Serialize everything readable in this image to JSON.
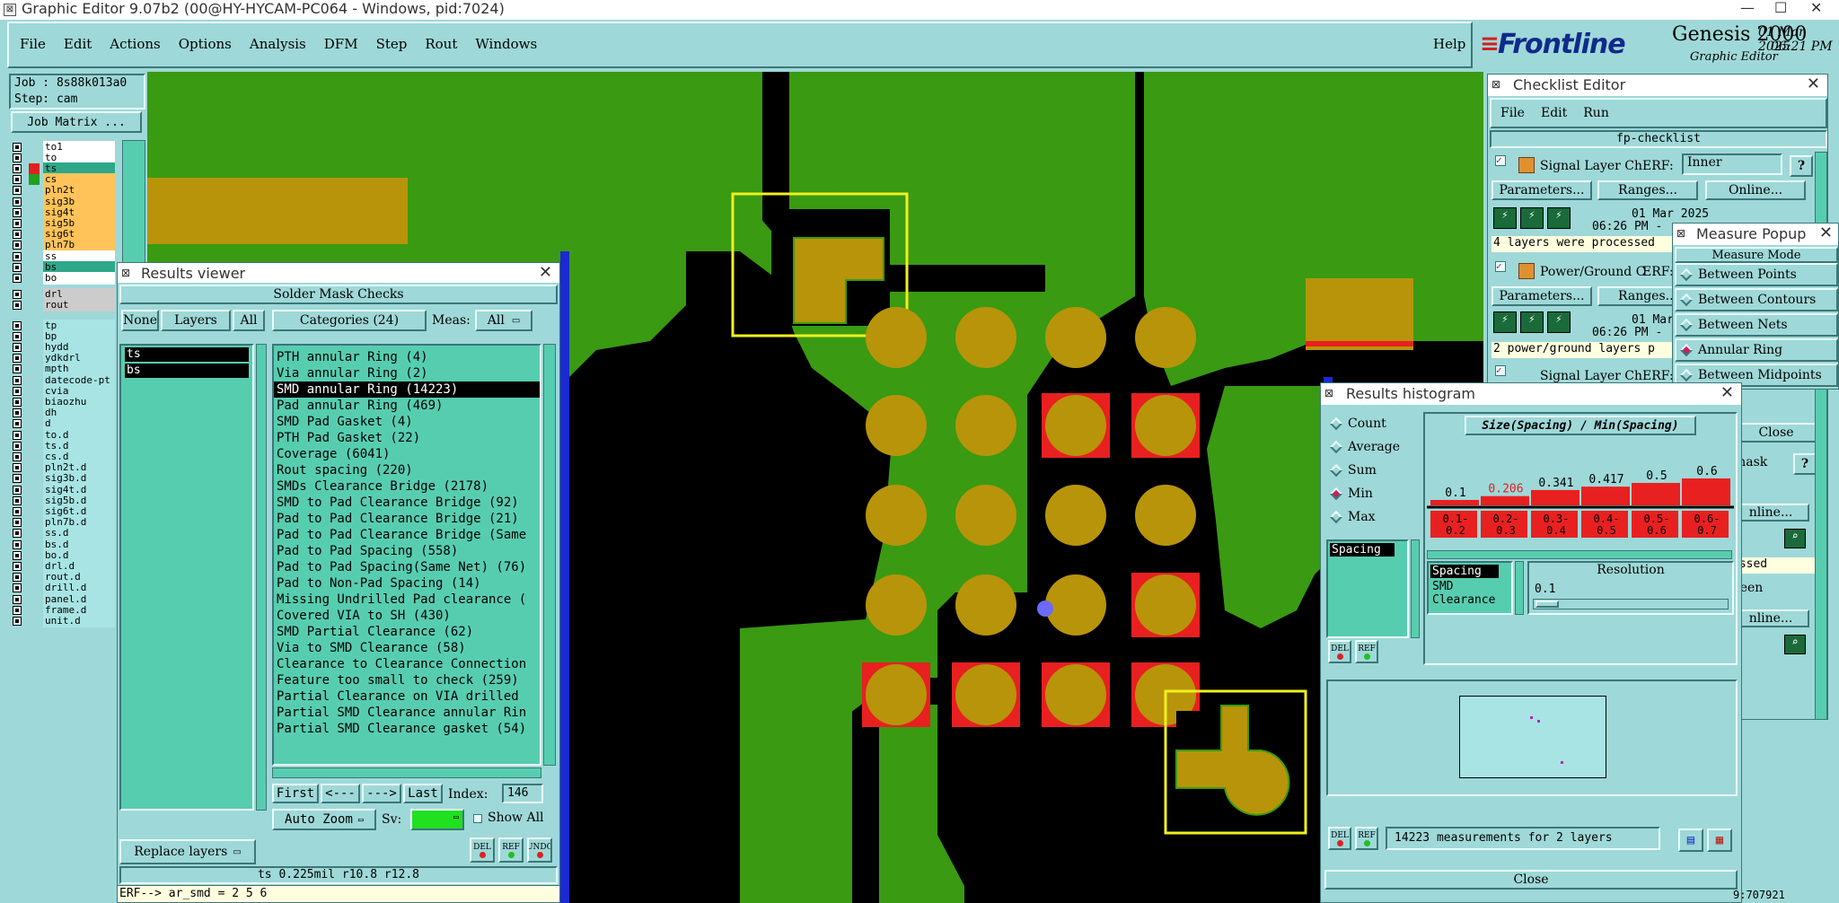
{
  "window": {
    "title": "Graphic Editor 9.07b2 (00@HY-HYCAM-PC064 - Windows, pid:7024)",
    "min_glyph": "—",
    "max_glyph": "☐",
    "close_glyph": "✕"
  },
  "menu": {
    "items": [
      "File",
      "Edit",
      "Actions",
      "Options",
      "Analysis",
      "DFM",
      "Step",
      "Rout",
      "Windows"
    ],
    "help": "Help"
  },
  "brand": {
    "logo": "Frontline",
    "product": "Genesis 2000",
    "subtitle": "Graphic Editor",
    "date": "01 Mar 2025",
    "time": "06:21 PM"
  },
  "job": {
    "job_label": "Job : 8s88k013a0",
    "step_label": "Step: cam",
    "matrix_button": "Job Matrix ..."
  },
  "layers": [
    {
      "name": "to1",
      "color": "#ffffff"
    },
    {
      "name": "to",
      "color": "#ffffff"
    },
    {
      "name": "ts",
      "color": "#2ea888"
    },
    {
      "name": "cs",
      "color": "#ffc35a"
    },
    {
      "name": "pln2t",
      "color": "#ffc35a"
    },
    {
      "name": "sig3b",
      "color": "#ffc35a"
    },
    {
      "name": "sig4t",
      "color": "#ffc35a"
    },
    {
      "name": "sig5b",
      "color": "#ffc35a"
    },
    {
      "name": "sig6t",
      "color": "#ffc35a"
    },
    {
      "name": "pln7b",
      "color": "#ffc35a"
    },
    {
      "name": "ss",
      "color": "#ffffff"
    },
    {
      "name": "bs",
      "color": "#2ea888"
    },
    {
      "name": "bo",
      "color": "#ffffff"
    },
    {
      "name": "drl",
      "color": "#cccccc"
    },
    {
      "name": "rout",
      "color": "#cccccc"
    },
    {
      "name": "tp",
      "color": "#a8e4e4"
    },
    {
      "name": "bp",
      "color": "#a8e4e4"
    },
    {
      "name": "hydd",
      "color": "#a8e4e4"
    },
    {
      "name": "ydkdrl",
      "color": "#a8e4e4"
    },
    {
      "name": "mpth",
      "color": "#a8e4e4"
    },
    {
      "name": "datecode-pt",
      "color": "#a8e4e4"
    },
    {
      "name": "cvia",
      "color": "#a8e4e4"
    },
    {
      "name": "biaozhu",
      "color": "#a8e4e4"
    },
    {
      "name": "dh",
      "color": "#a8e4e4"
    },
    {
      "name": "d",
      "color": "#a8e4e4"
    },
    {
      "name": "to.d",
      "color": "#a8e4e4"
    },
    {
      "name": "ts.d",
      "color": "#a8e4e4"
    },
    {
      "name": "cs.d",
      "color": "#a8e4e4"
    },
    {
      "name": "pln2t.d",
      "color": "#a8e4e4"
    },
    {
      "name": "sig3b.d",
      "color": "#a8e4e4"
    },
    {
      "name": "sig4t.d",
      "color": "#a8e4e4"
    },
    {
      "name": "sig5b.d",
      "color": "#a8e4e4"
    },
    {
      "name": "sig6t.d",
      "color": "#a8e4e4"
    },
    {
      "name": "pln7b.d",
      "color": "#a8e4e4"
    },
    {
      "name": "ss.d",
      "color": "#a8e4e4"
    },
    {
      "name": "bs.d",
      "color": "#a8e4e4"
    },
    {
      "name": "bo.d",
      "color": "#a8e4e4"
    },
    {
      "name": "drl.d",
      "color": "#a8e4e4"
    },
    {
      "name": "rout.d",
      "color": "#a8e4e4"
    },
    {
      "name": "drill.d",
      "color": "#a8e4e4"
    },
    {
      "name": "panel.d",
      "color": "#a8e4e4"
    },
    {
      "name": "frame.d",
      "color": "#a8e4e4"
    },
    {
      "name": "unit.d",
      "color": "#a8e4e4"
    }
  ],
  "results_viewer": {
    "title": "Results viewer",
    "header": "Solder Mask Checks",
    "none_btn": "None",
    "layers_btn": "Layers",
    "all_btn": "All",
    "categories_btn": "Categories (24)",
    "meas_label": "Meas:",
    "meas_value": "All",
    "layer_list": [
      "ts",
      "bs"
    ],
    "categories": [
      "PTH annular Ring (4)",
      "Via annular Ring (2)",
      "SMD annular Ring (14223)",
      "Pad annular Ring (469)",
      "SMD Pad Gasket (4)",
      "PTH Pad Gasket (22)",
      "Coverage (6041)",
      "Rout spacing (220)",
      "SMDs Clearance Bridge (2178)",
      "SMD to Pad Clearance Bridge (92)",
      "Pad to Pad Clearance Bridge (21)",
      "Pad to Pad Clearance Bridge (Same",
      "Pad to Pad Spacing (558)",
      "Pad to Pad Spacing(Same Net) (76)",
      "Pad to Non-Pad Spacing (14)",
      "Missing Undrilled Pad clearance (",
      "Covered VIA to SH (430)",
      "SMD Partial Clearance (62)",
      "Via to SMD Clearance (58)",
      "Clearance to Clearance Connection",
      "Feature too small to check (259)",
      "Partial Clearance on VIA drilled",
      "Partial SMD Clearance annular Rin",
      "Partial SMD Clearance gasket (54)"
    ],
    "selected_index": 2,
    "first_btn": "First",
    "prev_btn": "<---",
    "next_btn": "--->",
    "last_btn": "Last",
    "index_label": "Index:",
    "index_value": "146",
    "auto_zoom": "Auto Zoom",
    "sv_label": "Sv:",
    "show_all": "Show All",
    "replace_layers": "Replace layers",
    "del": "DEL",
    "ref": "REF",
    "undo": "UNDO",
    "status": "ts 0.225mil  r10.8  r12.8"
  },
  "erf_line": "ERF--> ar_smd = 2 5 6",
  "checklist": {
    "title": "Checklist Editor",
    "menu": [
      "File",
      "Edit",
      "Run"
    ],
    "name": "fp-checklist",
    "items": [
      {
        "name": "Signal Layer Ch",
        "erf_label": "ERF:",
        "erf_value": "Inner",
        "date": "01 Mar 2025",
        "time": "06:26 PM -",
        "message": "4 layers were processed"
      },
      {
        "name": "Power/Ground C",
        "erf_label": "ERF:",
        "date": "01 Mar 2",
        "time": "06:26 PM -",
        "message": "2 power/ground layers p"
      },
      {
        "name": "Signal Layer Ch",
        "erf_label": "ERF:"
      }
    ],
    "params_btn": "Parameters...",
    "ranges_btn": "Ranges...",
    "online_btn": "Online...",
    "help_glyph": "?",
    "right_fragments": [
      "mask",
      "nline...",
      "essed",
      "reen",
      "nline..."
    ]
  },
  "measure_popup": {
    "title": "Measure Popup",
    "mode_label": "Measure Mode",
    "modes": [
      "Between Points",
      "Between Contours",
      "Between Nets",
      "Annular Ring",
      "Between Midpoints"
    ],
    "selected_mode": 3,
    "close_fragment": "Close"
  },
  "histogram": {
    "title": "Results histogram",
    "options": [
      "Count",
      "Average",
      "Sum",
      "Min",
      "Max"
    ],
    "selected_option": 3,
    "header": "Size(Spacing) / Min(Spacing)",
    "list_item": "Spacing",
    "resolution_label": "Resolution",
    "resolution_value": "0.1",
    "field_items": [
      "Spacing",
      "SMD",
      "Clearance"
    ],
    "bars": [
      {
        "label": "0.1",
        "bin": "0.1-\n0.2",
        "value": 0.1
      },
      {
        "label": "0.206",
        "bin": "0.2-\n0.3",
        "value": 0.206
      },
      {
        "label": "0.341",
        "bin": "0.3-\n0.4",
        "value": 0.341
      },
      {
        "label": "0.417",
        "bin": "0.4-\n0.5",
        "value": 0.417
      },
      {
        "label": "0.5",
        "bin": "0.5-\n0.6",
        "value": 0.5
      },
      {
        "label": "0.6",
        "bin": "0.6-\n0.7",
        "value": 0.6
      }
    ],
    "summary": "14223 measurements for 2 layers",
    "close": "Close",
    "del": "DEL",
    "ref": "REF"
  },
  "bottom_fragment": "9:707921"
}
